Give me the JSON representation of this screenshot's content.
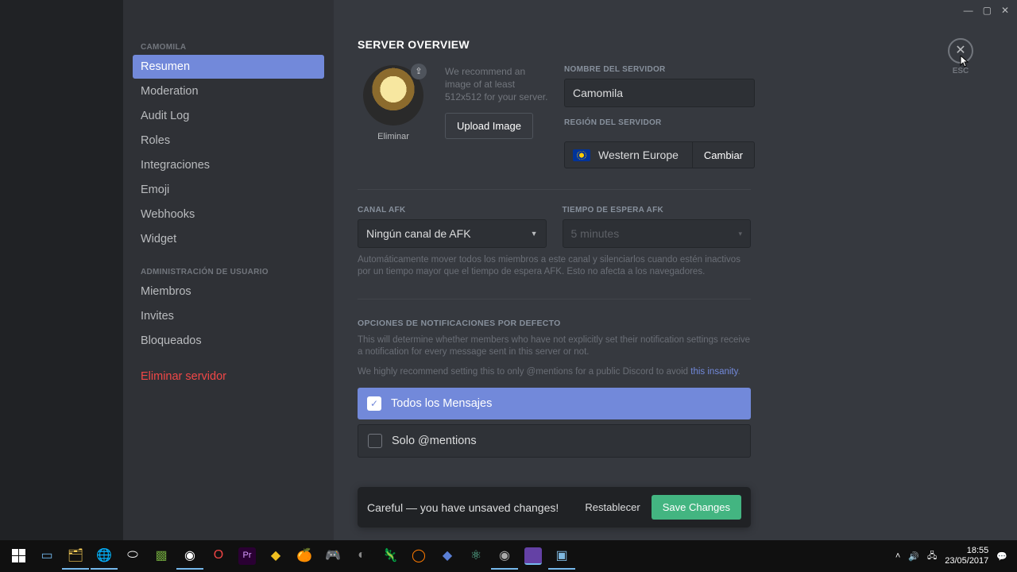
{
  "titlebar": {
    "minimize": "—",
    "maximize": "▢",
    "close_win": "✕"
  },
  "sidebar": {
    "category1": "CAMOMILA",
    "items1": [
      "Resumen",
      "Moderation",
      "Audit Log",
      "Roles",
      "Integraciones",
      "Emoji",
      "Webhooks",
      "Widget"
    ],
    "category2": "ADMINISTRACIÓN DE USUARIO",
    "items2": [
      "Miembros",
      "Invites",
      "Bloqueados"
    ],
    "delete": "Eliminar servidor"
  },
  "close": {
    "x": "✕",
    "esc": "ESC"
  },
  "overview": {
    "title": "SERVER OVERVIEW",
    "avatar_delete": "Eliminar",
    "recommend": "We recommend an image of at least 512x512 for your server.",
    "upload": "Upload Image",
    "name_label": "NOMBRE DEL SERVIDOR",
    "name_value": "Camomila",
    "region_label": "REGIÓN DEL SERVIDOR",
    "region_name": "Western Europe",
    "change": "Cambiar"
  },
  "afk": {
    "channel_label": "CANAL AFK",
    "channel_value": "Ningún canal de AFK",
    "timeout_label": "TIEMPO DE ESPERA AFK",
    "timeout_value": "5 minutes",
    "help": "Automáticamente mover todos los miembros a este canal y silenciarlos cuando estén inactivos por un tiempo mayor que el tiempo de espera AFK. Esto no afecta a los navegadores."
  },
  "notifications": {
    "title": "OPCIONES DE NOTIFICACIONES POR DEFECTO",
    "help1": "This will determine whether members who have not explicitly set their notification settings receive a notification for every message sent in this server or not.",
    "help2_pre": "We highly recommend setting this to only @mentions for a public Discord to avoid ",
    "help2_link": "this insanity",
    "opt_all": "Todos los Mensajes",
    "opt_mentions": "Solo @mentions",
    "check": "✓"
  },
  "savebar": {
    "text": "Careful — you have unsaved changes!",
    "reset": "Restablecer",
    "save": "Save Changes"
  },
  "taskbar": {
    "tray_up": "˄",
    "time": "18:55",
    "date": "23/05/2017"
  }
}
